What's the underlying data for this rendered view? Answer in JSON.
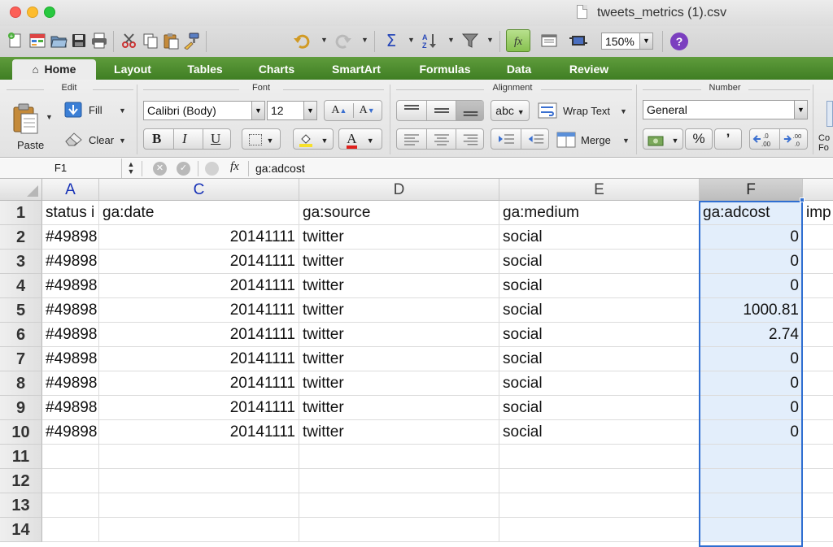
{
  "window": {
    "title": "tweets_metrics (1).csv"
  },
  "toolbar": {
    "zoom": "150%",
    "icons": [
      "new-icon",
      "templates-icon",
      "open-icon",
      "save-icon",
      "print-icon",
      "cut-icon",
      "copy-icon",
      "paste-icon",
      "format-painter-icon",
      "undo-icon",
      "redo-icon",
      "autosum-icon",
      "sort-icon",
      "filter-icon",
      "formula-builder-icon",
      "toolbox-icon",
      "media-icon",
      "help-icon"
    ]
  },
  "tabs": [
    "Home",
    "Layout",
    "Tables",
    "Charts",
    "SmartArt",
    "Formulas",
    "Data",
    "Review"
  ],
  "ribbon": {
    "edit": {
      "label": "Edit",
      "paste": "Paste",
      "fill": "Fill",
      "clear": "Clear"
    },
    "font": {
      "label": "Font",
      "name": "Calibri (Body)",
      "size": "12",
      "bold": "B",
      "italic": "I",
      "underline": "U",
      "grow": "A",
      "shrink": "A",
      "color": "A"
    },
    "alignment": {
      "label": "Alignment",
      "orientation": "abc",
      "wrap": "Wrap Text",
      "merge": "Merge"
    },
    "number": {
      "label": "Number",
      "format": "General",
      "percent": "%",
      "comma": "’",
      "cut_label": "Co Fo"
    }
  },
  "formula_bar": {
    "name_box": "F1",
    "fx": "fx",
    "value": "ga:adcost"
  },
  "grid": {
    "columns": [
      {
        "letter": "A",
        "style": "blue"
      },
      {
        "letter": "C",
        "style": "blue"
      },
      {
        "letter": "D",
        "style": ""
      },
      {
        "letter": "E",
        "style": ""
      },
      {
        "letter": "F",
        "style": "selected"
      }
    ],
    "row_numbers": [
      "1",
      "2",
      "3",
      "4",
      "5",
      "6",
      "7",
      "8",
      "9",
      "10",
      "11",
      "12",
      "13",
      "14"
    ],
    "header_row": [
      "status i",
      "ga:date",
      "ga:source",
      "ga:medium",
      "ga:adcost",
      "imp"
    ],
    "rows": [
      [
        "#49898",
        "20141111",
        "twitter",
        "social",
        "0"
      ],
      [
        "#49898",
        "20141111",
        "twitter",
        "social",
        "0"
      ],
      [
        "#49898",
        "20141111",
        "twitter",
        "social",
        "0"
      ],
      [
        "#49898",
        "20141111",
        "twitter",
        "social",
        "1000.81"
      ],
      [
        "#49898",
        "20141111",
        "twitter",
        "social",
        "2.74"
      ],
      [
        "#49898",
        "20141111",
        "twitter",
        "social",
        "0"
      ],
      [
        "#49898",
        "20141111",
        "twitter",
        "social",
        "0"
      ],
      [
        "#49898",
        "20141111",
        "twitter",
        "social",
        "0"
      ],
      [
        "#49898",
        "20141111",
        "twitter",
        "social",
        "0"
      ]
    ],
    "selection_color": "#2f6ed1",
    "ribbon_accent": "#4a8a2c"
  }
}
